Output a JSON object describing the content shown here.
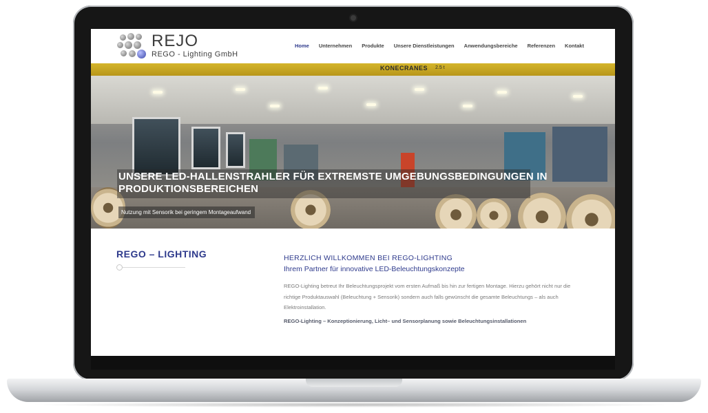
{
  "brand": {
    "logo_title": "REJO",
    "logo_subtitle": "REGO - Lighting GmbH"
  },
  "nav": {
    "items": [
      {
        "label": "Home",
        "active": true
      },
      {
        "label": "Unternehmen",
        "active": false
      },
      {
        "label": "Produkte",
        "active": false
      },
      {
        "label": "Unsere Dienstleistungen",
        "active": false
      },
      {
        "label": "Anwendungsbereiche",
        "active": false
      },
      {
        "label": "Referenzen",
        "active": false
      },
      {
        "label": "Kontakt",
        "active": false
      }
    ]
  },
  "hero": {
    "crane_label": "KONECRANES",
    "crane_load": "2.5 t",
    "title": "UNSERE LED-HALLENSTRAHLER FÜR EXTREMSTE UMGEBUNGSBEDINGUNGEN IN PRODUKTIONSBEREICHEN",
    "subtitle": "Nutzung mit Sensorik bei geringem Montageaufwand"
  },
  "sidebar": {
    "title": "REGO – LIGHTING"
  },
  "main": {
    "welcome": "HERZLICH WILLKOMMEN BEI REGO-LIGHTING",
    "partner": "Ihrem Partner für innovative LED-Beleuchtungskonzepte",
    "body": "REGO-Lighting betreut Ihr Beleuchtungsprojekt vom ersten Aufmaß bis hin zur fertigen Montage. Hierzu gehört nicht nur die richtige Produktauswahl (Beleuchtung + Sensorik) sondern auch falls gewünscht die gesamte Beleuchtungs – als auch Elektroinstallation.",
    "tagline": "REGO-Lighting – Konzeptionierung, Licht– und Sensorplanung sowie Beleuchtungsinstallationen"
  },
  "colors": {
    "accent": "#2e3a8c",
    "crane_yellow": "#d4b52c",
    "laptop_bezel": "#161616"
  }
}
